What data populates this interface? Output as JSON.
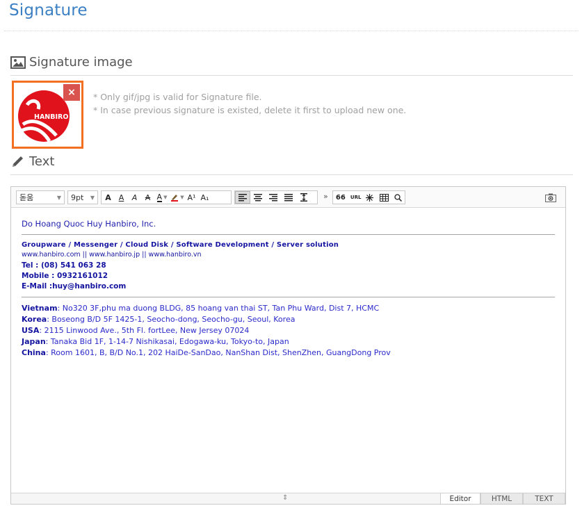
{
  "page": {
    "title": "Signature"
  },
  "sections": {
    "image": {
      "heading": "Signature image"
    },
    "text": {
      "heading": "Text"
    }
  },
  "signature_image": {
    "logo_text": "HANBIRO",
    "delete_label": "×",
    "hints": [
      "* Only gif/jpg is valid for Signature file.",
      "* In case previous signature is existed, delete it first to upload new one."
    ]
  },
  "editor": {
    "toolbar": {
      "font_family": "돋움",
      "font_size": "9pt",
      "more": "»",
      "buttons": [
        {
          "name": "bold",
          "label": "A"
        },
        {
          "name": "underline",
          "label": "A"
        },
        {
          "name": "italic",
          "label": "A"
        },
        {
          "name": "strikethrough",
          "label": "A"
        },
        {
          "name": "font-color",
          "label": "A"
        },
        {
          "name": "highlight",
          "label": ""
        },
        {
          "name": "superscript",
          "label": "A¹"
        },
        {
          "name": "subscript",
          "label": "A₁"
        }
      ],
      "url_label": "URL",
      "quote_label": "66"
    },
    "content": {
      "name_line": "Do Hoang Quoc Huy Hanbiro, Inc.",
      "tagline": "Groupware / Messenger / Cloud Disk / Software Development / Server solution",
      "weblinks": "www.hanbiro.com  ||  www.hanbiro.jp  ||  www.hanbiro.vn",
      "tel": "Tel : (08) 541 063 28",
      "mobile": "Mobile : 0932161012",
      "email": "E-Mail :huy@hanbiro.com",
      "addresses": [
        {
          "country": "Vietnam",
          "address": ": No320 3F,phu ma duong BLDG, 85 hoang van thai ST, Tan Phu Ward, Dist 7, HCMC"
        },
        {
          "country": "Korea",
          "address": ": Boseong B/D 5F 1425-1, Seocho-dong, Seocho-gu, Seoul, Korea"
        },
        {
          "country": "USA",
          "address": ": 2115 Linwood Ave., 5th Fl. fortLee, New Jersey 07024"
        },
        {
          "country": "Japan",
          "address": ": Tanaka Bid 1F, 1-14-7 Nishikasai, Edogawa-ku, Tokyo-to, Japan"
        },
        {
          "country": "China",
          "address": ": Room 1601, B, B/D No.1, 202 HaiDe-SanDao, NanShan Dist, ShenZhen, GuangDong Prov"
        }
      ]
    },
    "modes": {
      "editor": "Editor",
      "html": "HTML",
      "text": "TEXT",
      "active": "Editor"
    },
    "resize_handle": "⇕"
  },
  "colors": {
    "title": "#3b7fc4",
    "accent_border": "#f36f21",
    "delete_button": "#d9534f",
    "signature_text": "#1414a0",
    "logo_red": "#e0121c"
  }
}
